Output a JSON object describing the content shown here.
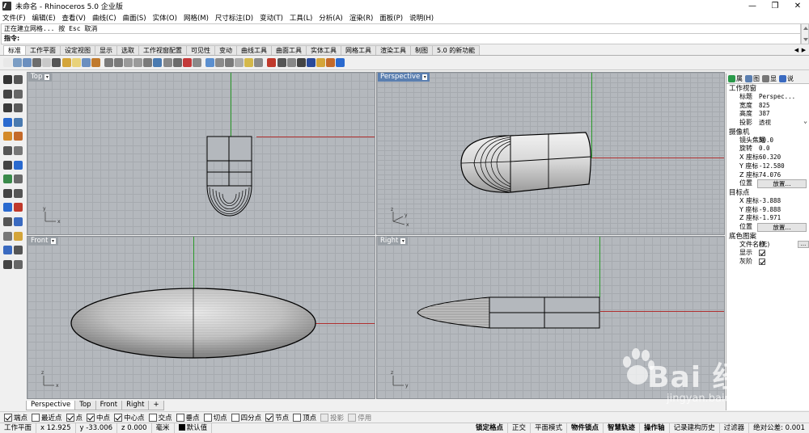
{
  "window": {
    "title": "未命名 - Rhinoceros  5.0 企业版",
    "controls": [
      "—",
      "❐",
      "✕"
    ]
  },
  "menu": [
    "文件(F)",
    "编辑(E)",
    "查看(V)",
    "曲线(C)",
    "曲面(S)",
    "实体(O)",
    "网格(M)",
    "尺寸标注(D)",
    "变动(T)",
    "工具(L)",
    "分析(A)",
    "渲染(R)",
    "面板(P)",
    "说明(H)"
  ],
  "command": {
    "history": "正在建立网格... 按 Esc 取消",
    "prompt": "指令:"
  },
  "toolbar_tabs": [
    "标准",
    "工作平面",
    "设定视图",
    "显示",
    "选取",
    "工作视窗配置",
    "可见性",
    "变动",
    "曲线工具",
    "曲面工具",
    "实体工具",
    "网格工具",
    "渲染工具",
    "制图",
    "5.0 的新功能"
  ],
  "toolbar_scroll": [
    "◀",
    "▶"
  ],
  "toolbar_icon_colors": [
    "#e8e8e8",
    "#7b9dc4",
    "#6b8fbf",
    "#6d6d6d",
    "#c9c9c9",
    "#555555",
    "#d4a53a",
    "#e8d27a",
    "#6b8fbf",
    "#c07a2e",
    "#7a7a7a",
    "#7a7a7a",
    "#9a9a9a",
    "#9a9a9a",
    "#7a7a7a",
    "#4a7ab0",
    "#888888",
    "#6b6b6b",
    "#c33a3a",
    "#8a8a8a",
    "#5b8fcf",
    "#8a8a8a",
    "#7a7a7a",
    "#aaaaaa",
    "#d4b84a",
    "#8a8a8a",
    "#c0392b",
    "#555555",
    "#888888",
    "#444444",
    "#2a4a9a",
    "#d4a53a",
    "#c46a2a",
    "#2a6acf"
  ],
  "viewports": {
    "top": {
      "label": "Top"
    },
    "perspective": {
      "label": "Perspective"
    },
    "front": {
      "label": "Front"
    },
    "right": {
      "label": "Right"
    }
  },
  "viewport_tabs": [
    "Perspective",
    "Top",
    "Front",
    "Right",
    "+"
  ],
  "osnaps": [
    {
      "label": "端点",
      "checked": true
    },
    {
      "label": "最近点",
      "checked": false
    },
    {
      "label": "点",
      "checked": true
    },
    {
      "label": "中点",
      "checked": true
    },
    {
      "label": "中心点",
      "checked": true
    },
    {
      "label": "交点",
      "checked": false
    },
    {
      "label": "垂点",
      "checked": false
    },
    {
      "label": "切点",
      "checked": false
    },
    {
      "label": "四分点",
      "checked": false
    },
    {
      "label": "节点",
      "checked": true
    },
    {
      "label": "顶点",
      "checked": false
    },
    {
      "label": "投影",
      "checked": false,
      "disabled": true
    },
    {
      "label": "停用",
      "checked": false,
      "disabled": true
    }
  ],
  "status": {
    "cplane": "工作平面",
    "x": "x 12.925",
    "y": "y -33.006",
    "z": "z 0.000",
    "unit": "毫米",
    "layer": "默认值",
    "grid_snap": "锁定格点",
    "ortho": "正交",
    "planar": "平面模式",
    "osnap": "物件锁点",
    "smarttrack": "智慧轨迹",
    "gumball": "操作轴",
    "history": "记录建构历史",
    "filter": "过滤器",
    "tolerance": "绝对公差: 0.001"
  },
  "panel": {
    "tabs": [
      "属",
      "图",
      "显",
      "说"
    ],
    "viewport_section": "工作视窗",
    "rows_viewport": [
      {
        "k": "标题",
        "v": "Perspec..."
      },
      {
        "k": "宽度",
        "v": "825"
      },
      {
        "k": "高度",
        "v": "387"
      },
      {
        "k": "投影",
        "v": "透视"
      }
    ],
    "camera_section": "摄像机",
    "rows_camera": [
      {
        "k": "镜头焦距",
        "v": "50.0"
      },
      {
        "k": "旋转",
        "v": "0.0"
      },
      {
        "k": "X 座标",
        "v": "60.320"
      },
      {
        "k": "Y 座标",
        "v": "-12.580"
      },
      {
        "k": "Z 座标",
        "v": "74.076"
      }
    ],
    "camera_place": {
      "k": "位置",
      "v": "放置..."
    },
    "target_section": "目标点",
    "rows_target": [
      {
        "k": "X 座标",
        "v": "-3.888"
      },
      {
        "k": "Y 座标",
        "v": "-9.888"
      },
      {
        "k": "Z 座标",
        "v": "-1.971"
      }
    ],
    "target_place": {
      "k": "位置",
      "v": "放置..."
    },
    "wallpaper_section": "底色图案",
    "file_name": {
      "k": "文件名称",
      "v": "(无)",
      "btn": "..."
    },
    "show": {
      "k": "显示"
    },
    "gray": {
      "k": "灰阶"
    }
  },
  "watermark": {
    "brand": "Bai  经验",
    "url": "jingyan.baidu.com"
  }
}
